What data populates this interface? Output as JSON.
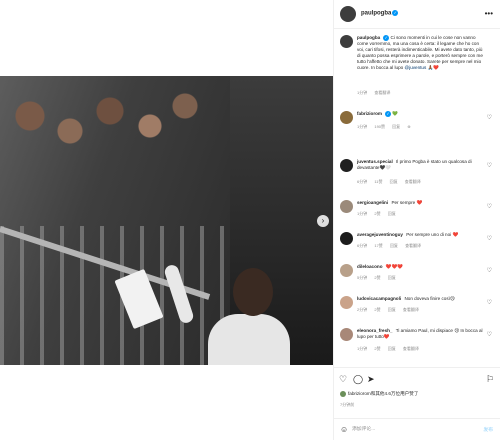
{
  "post": {
    "username": "paulpogba",
    "caption": "Ci sono momenti in cui le cose non vanno come vorremmo, ma una cosa è certa: il legame che ho con voi, cari tifosi, resterà indimenticabile. Mi avete dato tanto, più di quanto possa esprimere a parole, e porterò sempre con me tutto l'affetto che mi avete donato. Sarete per sempre nel mio cuore. In bocca al lupo",
    "caption_mention": "@juventus",
    "caption_emojis": "🙏🏾❤️",
    "caption_time": "1分钟",
    "caption_translate": "查看翻译"
  },
  "comments": [
    {
      "user": "fabriziorom",
      "text": "💚",
      "time": "1分钟",
      "likes": "190赞",
      "reply": "回复",
      "translate": "",
      "color": "#8a6b3a"
    },
    {
      "user": "juventus.special",
      "text": "Il primo Pogba è stato un qualcosa di devastante🖤🤍",
      "time": "6分钟",
      "likes": "11赞",
      "reply": "回复",
      "translate": "查看翻译",
      "color": "#202020"
    },
    {
      "user": "sergioangelini",
      "text": "Per sempre ❤️",
      "time": "1分钟",
      "likes": "2赞",
      "reply": "回复",
      "translate": "",
      "color": "#9b8a7a"
    },
    {
      "user": "averagejuventinoguy",
      "text": "Per sempre uno di noi ❤️",
      "time": "6分钟",
      "likes": "17赞",
      "reply": "回复",
      "translate": "查看翻译",
      "color": "#1c1c1c"
    },
    {
      "user": "dileloacono",
      "text": "❤️❤️❤️",
      "time": "5分钟",
      "likes": "2赞",
      "reply": "回复",
      "translate": "",
      "color": "#b8a08a"
    },
    {
      "user": "ludovicacampagnoli",
      "text": "Non doveva finire così😢",
      "time": "2分钟",
      "likes": "2赞",
      "reply": "回复",
      "translate": "查看翻译",
      "color": "#caa38a"
    },
    {
      "user": "eleonora_fresh_",
      "text": "Ti amiamo Paul, mi dispiace 😢 In bocca al lupo per tutto❤️",
      "time": "1分钟",
      "likes": "2赞",
      "reply": "回复",
      "translate": "查看翻译",
      "color": "#a88878"
    }
  ],
  "likes_line": "fabriziorom和其他4.6万位用户赞了",
  "likes_user": "fabriziorom",
  "posted_time": "7分钟前",
  "comment_placeholder": "添加评论...",
  "post_label": "发布",
  "icons": {
    "heart": "heart-icon",
    "comment": "comment-icon",
    "share": "share-icon",
    "save": "bookmark-icon",
    "emoji": "emoji-icon",
    "more": "more-icon"
  },
  "colors": {
    "verified": "#0095f6",
    "link": "#00376b",
    "muted": "#8e8e8e",
    "post_button": "#b2dffc"
  }
}
